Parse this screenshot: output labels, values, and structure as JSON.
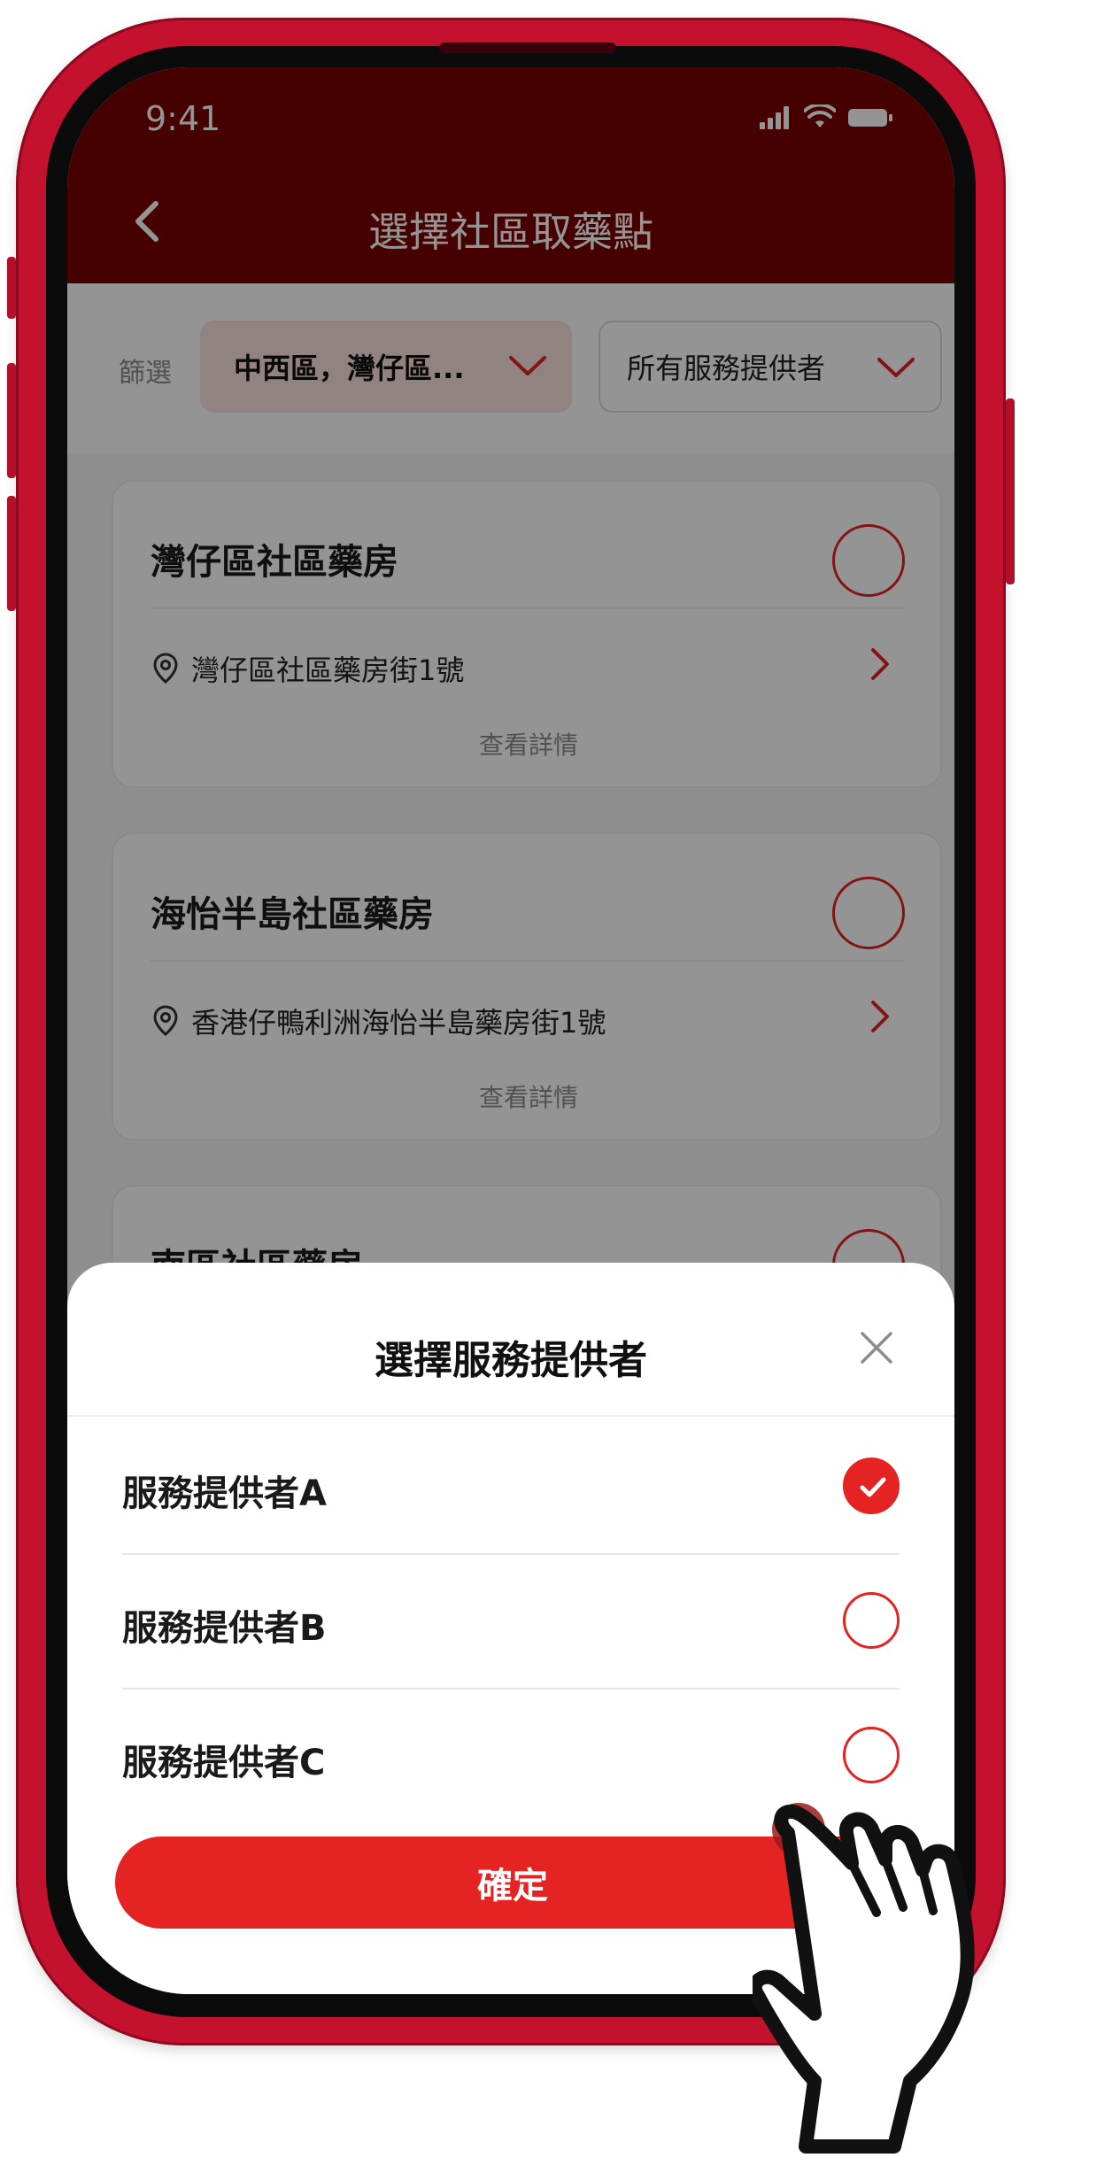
{
  "status_bar": {
    "time": "9:41"
  },
  "header": {
    "title": "選擇社區取藥點"
  },
  "filters": {
    "label": "篩選",
    "district": "中西區，灣仔區...",
    "provider": "所有服務提供者"
  },
  "pharmacies": [
    {
      "name": "灣仔區社區藥房",
      "address": "灣仔區社區藥房街1號",
      "detail": "查看詳情"
    },
    {
      "name": "海怡半島社區藥房",
      "address": "香港仔鴨利洲海怡半島藥房街1號",
      "detail": "查看詳情"
    },
    {
      "name": "南區社區藥房"
    }
  ],
  "sheet": {
    "title": "選擇服務提供者",
    "options": [
      {
        "label": "服務提供者A",
        "selected": true
      },
      {
        "label": "服務提供者B",
        "selected": false
      },
      {
        "label": "服務提供者C",
        "selected": false
      }
    ],
    "confirm_label": "確定"
  },
  "colors": {
    "header": "#7a0000",
    "accent": "#e42322",
    "frame": "#c4112d"
  },
  "icons": [
    "back-icon",
    "signal-icon",
    "wifi-icon",
    "battery-icon",
    "chevron-down-icon",
    "location-pin-icon",
    "chevron-right-icon",
    "close-icon",
    "check-icon",
    "hand-pointer-icon"
  ]
}
